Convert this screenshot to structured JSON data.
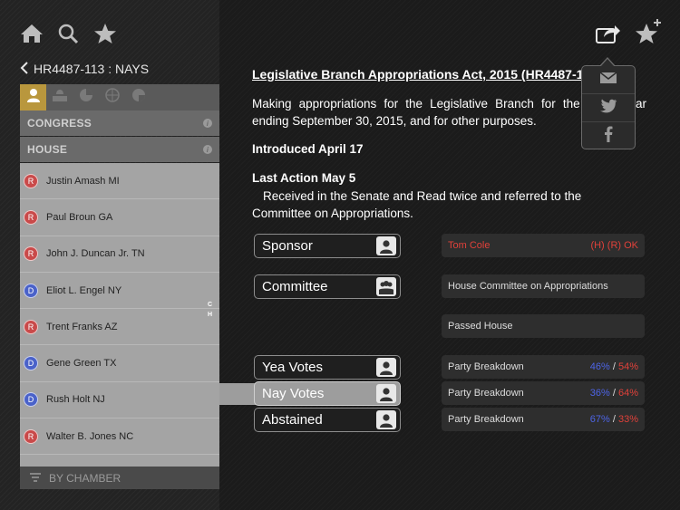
{
  "nav": {
    "back_label": "HR4487-113 : NAYS"
  },
  "sidebar": {
    "sections": [
      "CONGRESS",
      "HOUSE"
    ],
    "members": [
      {
        "party": "R",
        "name": "Justin Amash MI"
      },
      {
        "party": "R",
        "name": "Paul Broun GA"
      },
      {
        "party": "R",
        "name": "John J. Duncan Jr. TN"
      },
      {
        "party": "D",
        "name": "Eliot L. Engel NY",
        "index": "C"
      },
      {
        "party": "R",
        "name": "Trent Franks AZ",
        "index": "H"
      },
      {
        "party": "D",
        "name": "Gene Green TX"
      },
      {
        "party": "D",
        "name": "Rush Holt NJ"
      },
      {
        "party": "R",
        "name": "Walter B. Jones NC"
      }
    ],
    "bottom_label": "BY CHAMBER"
  },
  "bill": {
    "title": "Legislative Branch Appropriations Act, 2015 (HR4487-1",
    "description": "Making appropriations for the Legislative Branch for the fiscal year ending September 30, 2015, and for other purposes.",
    "introduced": "Introduced April 17",
    "last_action_label": "Last Action May 5",
    "last_action_text": "Received in the Senate and Read twice and referred to the Committee on Appropriations."
  },
  "buttons": {
    "sponsor": "Sponsor",
    "committee": "Committee",
    "yea": "Yea Votes",
    "nay": "Nay Votes",
    "abstained": "Abstained"
  },
  "info": {
    "sponsor_name": "Tom Cole",
    "sponsor_meta": "(H) (R) OK",
    "committee_name": "House Committee on Appropriations",
    "status": "Passed House",
    "breakdown_label": "Party Breakdown",
    "yea_dem": "46%",
    "yea_rep": "54%",
    "nay_dem": "36%",
    "nay_rep": "64%",
    "abs_dem": "67%",
    "abs_rep": "33%",
    "sep": "/"
  },
  "colors": {
    "accent": "#b9973d",
    "republican": "#e0413a",
    "democrat": "#4d64e6"
  },
  "icons": [
    "home-icon",
    "search-icon",
    "star-icon",
    "share-icon",
    "star-add-icon",
    "mail-icon",
    "twitter-icon",
    "facebook-icon",
    "person-icon"
  ]
}
